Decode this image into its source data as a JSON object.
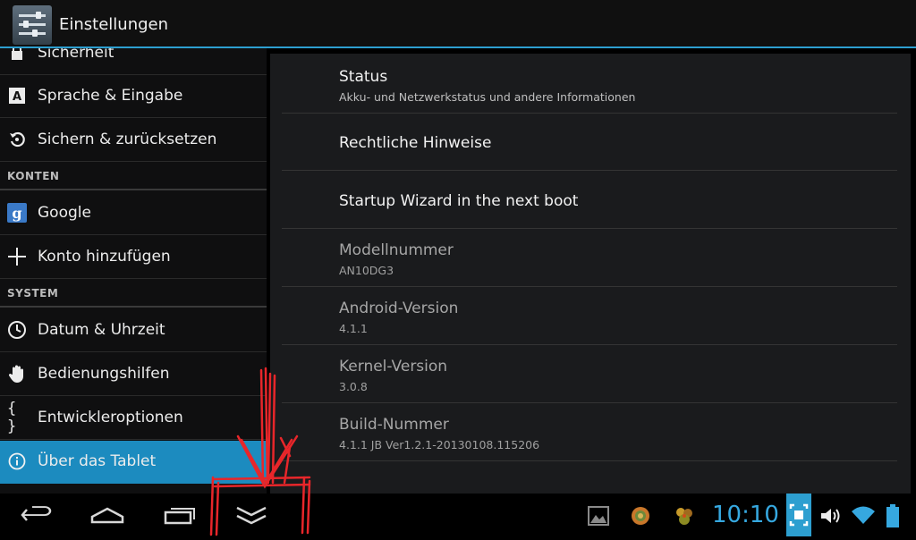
{
  "actionbar": {
    "title": "Einstellungen",
    "icon": "settings-sliders-icon"
  },
  "left_pane": {
    "items": [
      {
        "label": "Sicherheit",
        "icon": "lock-icon"
      },
      {
        "label": "Sprache & Eingabe",
        "icon": "keyboard-a-icon"
      },
      {
        "label": "Sichern & zurücksetzen",
        "icon": "backup-restore-icon"
      },
      {
        "label": "Google",
        "icon": "google-g-icon"
      },
      {
        "label": "Konto hinzufügen",
        "icon": "plus-icon"
      },
      {
        "label": "Datum & Uhrzeit",
        "icon": "clock-icon"
      },
      {
        "label": "Bedienungshilfen",
        "icon": "hand-icon"
      },
      {
        "label": "Entwickleroptionen",
        "icon": "braces-icon"
      },
      {
        "label": "Über das Tablet",
        "icon": "info-icon",
        "selected": true
      }
    ],
    "sections": {
      "accounts": "KONTEN",
      "system": "SYSTEM"
    }
  },
  "right_pane": {
    "items": [
      {
        "title": "Status",
        "summary": "Akku- und Netzwerkstatus und andere Informationen"
      },
      {
        "title": "Rechtliche Hinweise",
        "summary": ""
      },
      {
        "title": "Startup Wizard in the next boot",
        "summary": ""
      },
      {
        "title": "Modellnummer",
        "summary": "AN10DG3"
      },
      {
        "title": "Android-Version",
        "summary": "4.1.1"
      },
      {
        "title": "Kernel-Version",
        "summary": "3.0.8"
      },
      {
        "title": "Build-Nummer",
        "summary": "4.1.1 JB Ver1.2.1-20130108.115206"
      }
    ]
  },
  "navbar": {
    "buttons": [
      "back-icon",
      "home-icon",
      "recent-apps-icon",
      "hide-keyboard-icon"
    ],
    "status_icons": [
      "gallery-notification-icon",
      "app-notification-icon",
      "game-notification-icon",
      "screenshot-icon",
      "volume-icon",
      "wifi-icon",
      "battery-icon"
    ],
    "time": "10:10"
  },
  "colors": {
    "accent": "#2d9fd0",
    "selected": "#1c8bbf",
    "clock": "#36a8e0",
    "annotation": "#e8262a"
  }
}
